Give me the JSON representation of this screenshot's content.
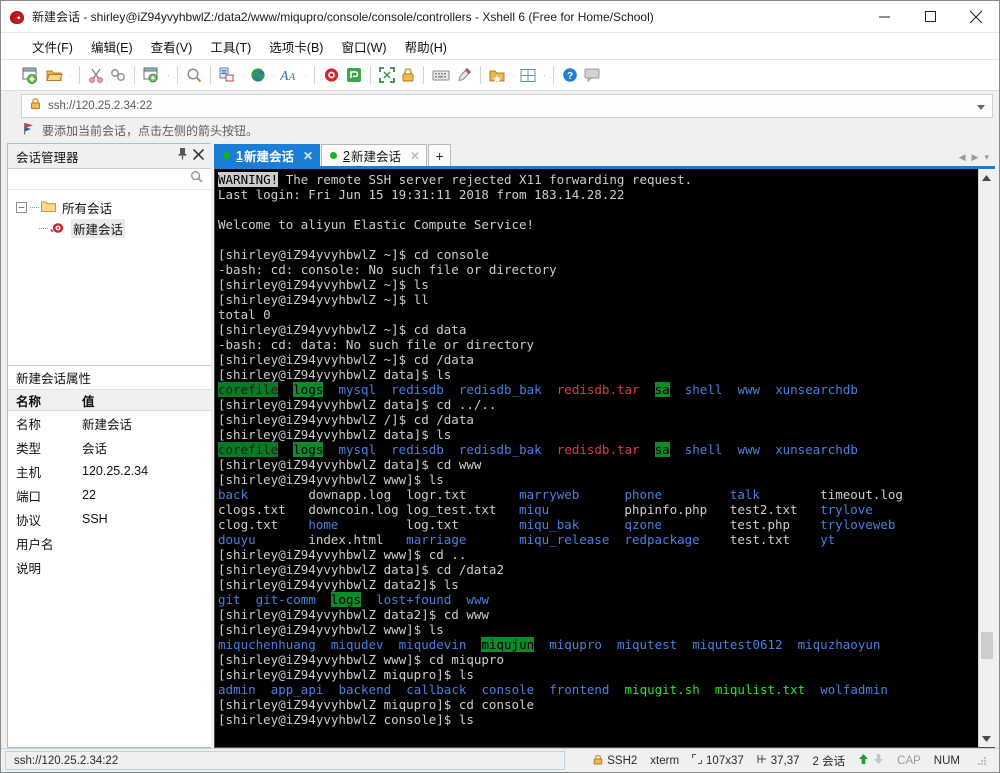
{
  "window": {
    "title": "新建会话 - shirley@iZ94yvyhbwlZ:/data2/www/miqupro/console/console/controllers - Xshell 6 (Free for Home/School)",
    "minimize": "–",
    "maximize": "□",
    "close": "✕"
  },
  "menubar": {
    "items": [
      {
        "label": "文件(F)",
        "name": "menu-file"
      },
      {
        "label": "编辑(E)",
        "name": "menu-edit"
      },
      {
        "label": "查看(V)",
        "name": "menu-view"
      },
      {
        "label": "工具(T)",
        "name": "menu-tools"
      },
      {
        "label": "选项卡(B)",
        "name": "menu-tabs"
      },
      {
        "label": "窗口(W)",
        "name": "menu-window"
      },
      {
        "label": "帮助(H)",
        "name": "menu-help"
      }
    ]
  },
  "toolbar": {
    "icons": [
      "new-session-icon",
      "open-folder-icon",
      "cut-icon",
      "copy-link-icon",
      "session-properties-icon",
      "find-icon",
      "transfer-file-icon",
      "globe-icon",
      "font-icon",
      "xshell-icon",
      "xftp-icon",
      "fullscreen-icon",
      "lock-icon",
      "keyboard-icon",
      "highlight-icon",
      "session-folder-icon",
      "layout-icon",
      "help-icon",
      "comment-icon"
    ]
  },
  "address_bar": {
    "value": "ssh://120.25.2.34:22",
    "lock_icon": "lock-icon",
    "dropdown_icon": "chevron-down-icon"
  },
  "notice": {
    "icon": "flag-icon",
    "text": "要添加当前会话，点击左侧的箭头按钮。"
  },
  "session_manager": {
    "title": "会话管理器",
    "pin_icon": "pin-icon",
    "close_icon": "close-icon",
    "search_placeholder": "",
    "search_icon": "search-icon",
    "tree": {
      "root_label": "所有会话",
      "children": [
        {
          "label": "新建会话",
          "icon": "snail-icon"
        }
      ]
    }
  },
  "properties": {
    "title": "新建会话属性",
    "columns": [
      "名称",
      "值"
    ],
    "rows": [
      {
        "name": "名称",
        "value": "新建会话"
      },
      {
        "name": "类型",
        "value": "会话"
      },
      {
        "name": "主机",
        "value": "120.25.2.34"
      },
      {
        "name": "端口",
        "value": "22"
      },
      {
        "name": "协议",
        "value": "SSH"
      },
      {
        "name": "用户名",
        "value": ""
      },
      {
        "name": "说明",
        "value": ""
      }
    ]
  },
  "tabs": {
    "items": [
      {
        "num": "1",
        "label": "新建会话",
        "active": true,
        "close": "✕",
        "dot": "status-dot-green"
      },
      {
        "num": "2",
        "label": "新建会话",
        "active": false,
        "close": "✕",
        "dot": "status-dot-green"
      }
    ],
    "add_label": "+",
    "nav_prev": "◀",
    "nav_next": "▶",
    "nav_menu": "▾"
  },
  "terminal": {
    "lines": [
      [
        {
          "t": "WARNING!",
          "c": "inv"
        },
        {
          "t": " The remote SSH server rejected X11 forwarding request.",
          "c": "white"
        }
      ],
      [
        {
          "t": "Last login: Fri Jun 15 19:31:11 2018 from 183.14.28.22",
          "c": "white"
        }
      ],
      [
        {
          "t": "",
          "c": "white"
        }
      ],
      [
        {
          "t": "Welcome to aliyun Elastic Compute Service!",
          "c": "white"
        }
      ],
      [
        {
          "t": "",
          "c": "white"
        }
      ],
      [
        {
          "t": "[shirley@iZ94yvyhbwlZ ~]$ cd console",
          "c": "white"
        }
      ],
      [
        {
          "t": "-bash: cd: console: No such file or directory",
          "c": "white"
        }
      ],
      [
        {
          "t": "[shirley@iZ94yvyhbwlZ ~]$ ls",
          "c": "white"
        }
      ],
      [
        {
          "t": "[shirley@iZ94yvyhbwlZ ~]$ ll",
          "c": "white"
        }
      ],
      [
        {
          "t": "total 0",
          "c": "white"
        }
      ],
      [
        {
          "t": "[shirley@iZ94yvyhbwlZ ~]$ cd data",
          "c": "white"
        }
      ],
      [
        {
          "t": "-bash: cd: data: No such file or directory",
          "c": "white"
        }
      ],
      [
        {
          "t": "[shirley@iZ94yvyhbwlZ ~]$ cd /data",
          "c": "white"
        }
      ],
      [
        {
          "t": "[shirley@iZ94yvyhbwlZ data]$ ls",
          "c": "white"
        }
      ],
      [
        {
          "t": "corefile",
          "c": "hl-dark"
        },
        {
          "t": "  ",
          "c": "white"
        },
        {
          "t": "logs",
          "c": "hl-green"
        },
        {
          "t": "  ",
          "c": "white"
        },
        {
          "t": "mysql",
          "c": "blue"
        },
        {
          "t": "  ",
          "c": "white"
        },
        {
          "t": "redisdb",
          "c": "blue"
        },
        {
          "t": "  ",
          "c": "white"
        },
        {
          "t": "redisdb_bak",
          "c": "blue"
        },
        {
          "t": "  ",
          "c": "white"
        },
        {
          "t": "redisdb.tar",
          "c": "red"
        },
        {
          "t": "  ",
          "c": "white"
        },
        {
          "t": "sa",
          "c": "hl-green"
        },
        {
          "t": "  ",
          "c": "white"
        },
        {
          "t": "shell",
          "c": "blue"
        },
        {
          "t": "  ",
          "c": "white"
        },
        {
          "t": "www",
          "c": "blue"
        },
        {
          "t": "  ",
          "c": "white"
        },
        {
          "t": "xunsearchdb",
          "c": "blue"
        }
      ],
      [
        {
          "t": "[shirley@iZ94yvyhbwlZ data]$ cd ../..",
          "c": "white"
        }
      ],
      [
        {
          "t": "[shirley@iZ94yvyhbwlZ /]$ cd /data",
          "c": "white"
        }
      ],
      [
        {
          "t": "[shirley@iZ94yvyhbwlZ data]$ ls",
          "c": "white"
        }
      ],
      [
        {
          "t": "corefile",
          "c": "hl-dark"
        },
        {
          "t": "  ",
          "c": "white"
        },
        {
          "t": "logs",
          "c": "hl-green"
        },
        {
          "t": "  ",
          "c": "white"
        },
        {
          "t": "mysql",
          "c": "blue"
        },
        {
          "t": "  ",
          "c": "white"
        },
        {
          "t": "redisdb",
          "c": "blue"
        },
        {
          "t": "  ",
          "c": "white"
        },
        {
          "t": "redisdb_bak",
          "c": "blue"
        },
        {
          "t": "  ",
          "c": "white"
        },
        {
          "t": "redisdb.tar",
          "c": "red"
        },
        {
          "t": "  ",
          "c": "white"
        },
        {
          "t": "sa",
          "c": "hl-green"
        },
        {
          "t": "  ",
          "c": "white"
        },
        {
          "t": "shell",
          "c": "blue"
        },
        {
          "t": "  ",
          "c": "white"
        },
        {
          "t": "www",
          "c": "blue"
        },
        {
          "t": "  ",
          "c": "white"
        },
        {
          "t": "xunsearchdb",
          "c": "blue"
        }
      ],
      [
        {
          "t": "[shirley@iZ94yvyhbwlZ data]$ cd www",
          "c": "white"
        }
      ],
      [
        {
          "t": "[shirley@iZ94yvyhbwlZ www]$ ls",
          "c": "white"
        }
      ],
      [
        {
          "t": "back",
          "c": "blue"
        },
        {
          "t": "        ",
          "c": "white"
        },
        {
          "t": "downapp.log",
          "c": "white"
        },
        {
          "t": "  ",
          "c": "white"
        },
        {
          "t": "logr.txt",
          "c": "white"
        },
        {
          "t": "       ",
          "c": "white"
        },
        {
          "t": "marryweb",
          "c": "blue"
        },
        {
          "t": "      ",
          "c": "white"
        },
        {
          "t": "phone",
          "c": "blue"
        },
        {
          "t": "         ",
          "c": "white"
        },
        {
          "t": "talk",
          "c": "blue"
        },
        {
          "t": "        ",
          "c": "white"
        },
        {
          "t": "timeout.log",
          "c": "white"
        }
      ],
      [
        {
          "t": "clogs.txt",
          "c": "white"
        },
        {
          "t": "   ",
          "c": "white"
        },
        {
          "t": "downcoin.log",
          "c": "white"
        },
        {
          "t": " ",
          "c": "white"
        },
        {
          "t": "log_test.txt",
          "c": "white"
        },
        {
          "t": "   ",
          "c": "white"
        },
        {
          "t": "miqu",
          "c": "blue"
        },
        {
          "t": "          ",
          "c": "white"
        },
        {
          "t": "phpinfo.php",
          "c": "white"
        },
        {
          "t": "   ",
          "c": "white"
        },
        {
          "t": "test2.txt",
          "c": "white"
        },
        {
          "t": "   ",
          "c": "white"
        },
        {
          "t": "trylove",
          "c": "blue"
        }
      ],
      [
        {
          "t": "clog.txt",
          "c": "white"
        },
        {
          "t": "    ",
          "c": "white"
        },
        {
          "t": "home",
          "c": "blue"
        },
        {
          "t": "         ",
          "c": "white"
        },
        {
          "t": "log.txt",
          "c": "white"
        },
        {
          "t": "        ",
          "c": "white"
        },
        {
          "t": "miqu_bak",
          "c": "blue"
        },
        {
          "t": "      ",
          "c": "white"
        },
        {
          "t": "qzone",
          "c": "blue"
        },
        {
          "t": "         ",
          "c": "white"
        },
        {
          "t": "test.php",
          "c": "white"
        },
        {
          "t": "    ",
          "c": "white"
        },
        {
          "t": "tryloveweb",
          "c": "blue"
        }
      ],
      [
        {
          "t": "douyu",
          "c": "blue"
        },
        {
          "t": "       ",
          "c": "white"
        },
        {
          "t": "index.html",
          "c": "white"
        },
        {
          "t": "   ",
          "c": "white"
        },
        {
          "t": "marriage",
          "c": "blue"
        },
        {
          "t": "       ",
          "c": "white"
        },
        {
          "t": "miqu_release",
          "c": "blue"
        },
        {
          "t": "  ",
          "c": "white"
        },
        {
          "t": "redpackage",
          "c": "blue"
        },
        {
          "t": "    ",
          "c": "white"
        },
        {
          "t": "test.txt",
          "c": "white"
        },
        {
          "t": "    ",
          "c": "white"
        },
        {
          "t": "yt",
          "c": "blue"
        }
      ],
      [
        {
          "t": "[shirley@iZ94yvyhbwlZ www]$ cd ..",
          "c": "white"
        }
      ],
      [
        {
          "t": "[shirley@iZ94yvyhbwlZ data]$ cd /data2",
          "c": "white"
        }
      ],
      [
        {
          "t": "[shirley@iZ94yvyhbwlZ data2]$ ls",
          "c": "white"
        }
      ],
      [
        {
          "t": "git",
          "c": "blue"
        },
        {
          "t": "  ",
          "c": "white"
        },
        {
          "t": "git-comm",
          "c": "blue"
        },
        {
          "t": "  ",
          "c": "white"
        },
        {
          "t": "logs",
          "c": "hl-green"
        },
        {
          "t": "  ",
          "c": "white"
        },
        {
          "t": "lost+found",
          "c": "blue"
        },
        {
          "t": "  ",
          "c": "white"
        },
        {
          "t": "www",
          "c": "blue"
        }
      ],
      [
        {
          "t": "[shirley@iZ94yvyhbwlZ data2]$ cd www",
          "c": "white"
        }
      ],
      [
        {
          "t": "[shirley@iZ94yvyhbwlZ www]$ ls",
          "c": "white"
        }
      ],
      [
        {
          "t": "miquchenhuang",
          "c": "blue"
        },
        {
          "t": "  ",
          "c": "white"
        },
        {
          "t": "miqudev",
          "c": "blue"
        },
        {
          "t": "  ",
          "c": "white"
        },
        {
          "t": "miqudevin",
          "c": "blue"
        },
        {
          "t": "  ",
          "c": "white"
        },
        {
          "t": "miqujun",
          "c": "hl-green"
        },
        {
          "t": "  ",
          "c": "white"
        },
        {
          "t": "miqupro",
          "c": "blue"
        },
        {
          "t": "  ",
          "c": "white"
        },
        {
          "t": "miqutest",
          "c": "blue"
        },
        {
          "t": "  ",
          "c": "white"
        },
        {
          "t": "miqutest0612",
          "c": "blue"
        },
        {
          "t": "  ",
          "c": "white"
        },
        {
          "t": "miquzhaoyun",
          "c": "blue"
        }
      ],
      [
        {
          "t": "[shirley@iZ94yvyhbwlZ www]$ cd miqupro",
          "c": "white"
        }
      ],
      [
        {
          "t": "[shirley@iZ94yvyhbwlZ miqupro]$ ls",
          "c": "white"
        }
      ],
      [
        {
          "t": "admin",
          "c": "blue"
        },
        {
          "t": "  ",
          "c": "white"
        },
        {
          "t": "app_api",
          "c": "blue"
        },
        {
          "t": "  ",
          "c": "white"
        },
        {
          "t": "backend",
          "c": "blue"
        },
        {
          "t": "  ",
          "c": "white"
        },
        {
          "t": "callback",
          "c": "blue"
        },
        {
          "t": "  ",
          "c": "white"
        },
        {
          "t": "console",
          "c": "blue"
        },
        {
          "t": "  ",
          "c": "white"
        },
        {
          "t": "frontend",
          "c": "blue"
        },
        {
          "t": "  ",
          "c": "white"
        },
        {
          "t": "miqugit.sh",
          "c": "green"
        },
        {
          "t": "  ",
          "c": "white"
        },
        {
          "t": "miqulist.txt",
          "c": "green"
        },
        {
          "t": "  ",
          "c": "white"
        },
        {
          "t": "wolfadmin",
          "c": "blue"
        }
      ],
      [
        {
          "t": "[shirley@iZ94yvyhbwlZ miqupro]$ cd console",
          "c": "white"
        }
      ],
      [
        {
          "t": "[shirley@iZ94yvyhbwlZ console]$ ls",
          "c": "white"
        }
      ]
    ]
  },
  "statusbar": {
    "connection": "ssh://120.25.2.34:22",
    "security_icon": "lock-icon",
    "protocol": "SSH2",
    "terminal_type": "xterm",
    "size_icon": "screen-size-icon",
    "size": "107x37",
    "cursor_icon": "cursor-pos-icon",
    "cursor": "37,37",
    "sessions": "2 会话",
    "up_icon": "arrow-up-icon",
    "down_icon": "arrow-down-icon",
    "caps": "CAP",
    "num": "NUM"
  }
}
